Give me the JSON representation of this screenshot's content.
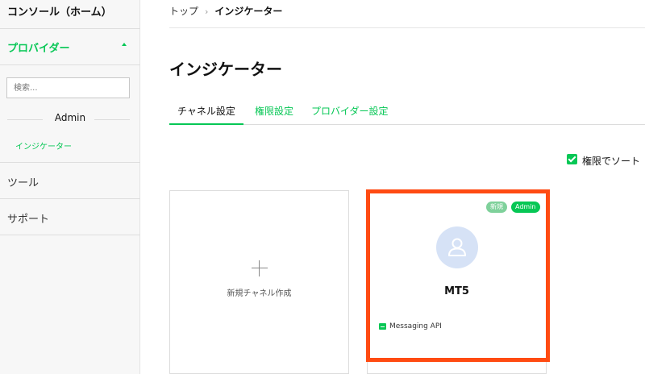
{
  "sidebar": {
    "console_label": "コンソール（ホーム）",
    "provider_label": "プロバイダー",
    "search_placeholder": "検索...",
    "group_label": "Admin",
    "active_item": "インジケーター",
    "tool_label": "ツール",
    "support_label": "サポート"
  },
  "breadcrumb": {
    "home": "トップ",
    "separator": "›",
    "current": "インジケーター"
  },
  "page": {
    "title": "インジケーター"
  },
  "tabs": [
    {
      "label": "チャネル設定",
      "active": true
    },
    {
      "label": "権限設定",
      "active": false
    },
    {
      "label": "プロバイダー設定",
      "active": false
    }
  ],
  "sort": {
    "label": "権限でソート",
    "checked": true
  },
  "new_channel": {
    "label": "新規チャネル作成"
  },
  "channel_card": {
    "badge_new": "新規",
    "badge_admin": "Admin",
    "name": "MT5",
    "type": "Messaging API"
  },
  "colors": {
    "accent": "#06c755",
    "highlight": "#ff4b12",
    "avatar_bg": "#d6e2f6"
  },
  "icons": {
    "avatar": "user-icon",
    "messaging": "message-icon",
    "add": "plus-icon",
    "collapse": "caret-up-icon"
  }
}
